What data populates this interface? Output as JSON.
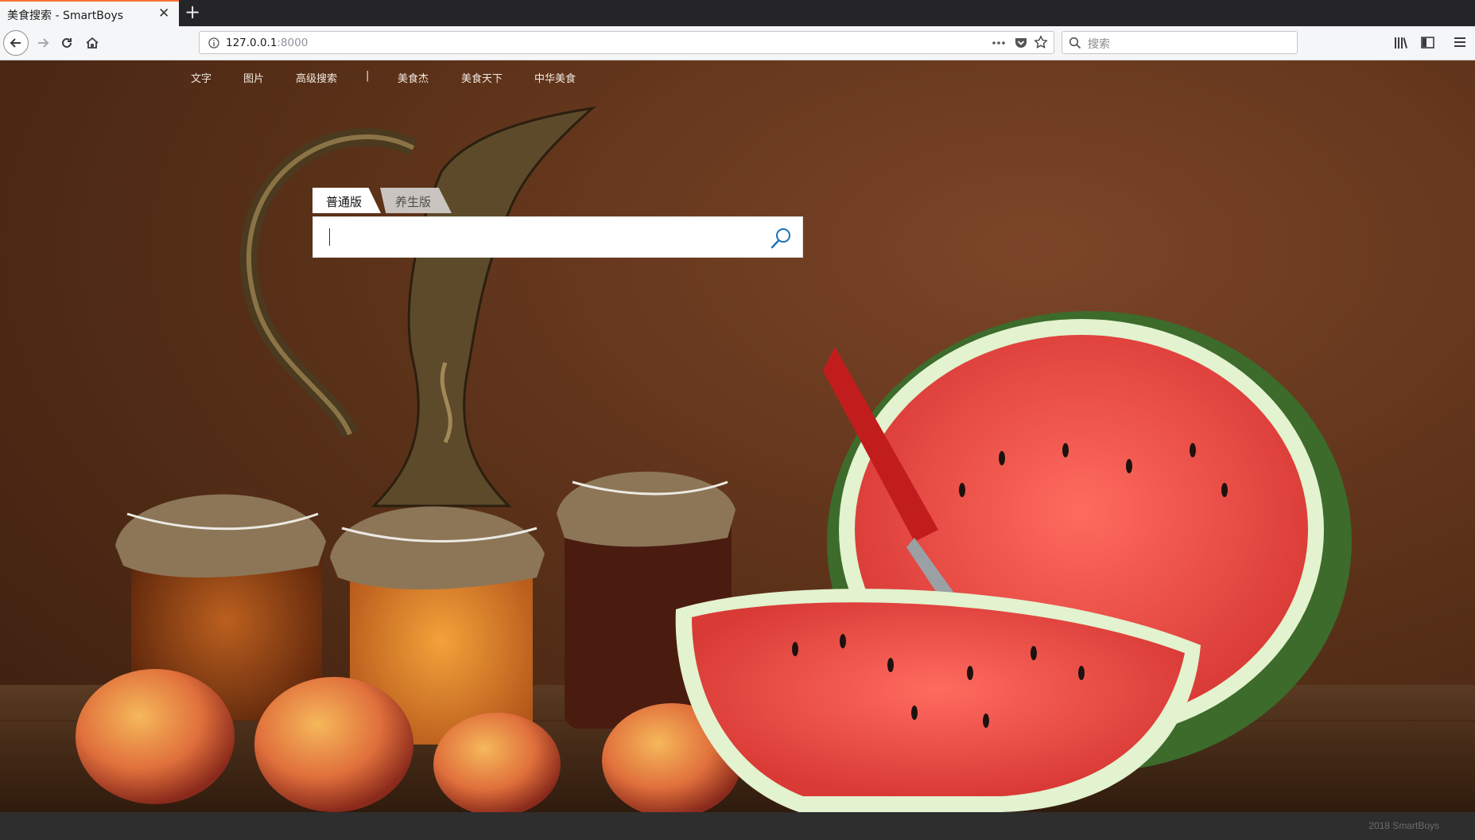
{
  "browser": {
    "tab_title": "美食搜索 - SmartBoys",
    "url_host": "127.0.0.1",
    "url_port": ":8000",
    "search_placeholder": "搜索",
    "accent_color": "#ff7139"
  },
  "nav_links": [
    "文字",
    "图片",
    "高级搜索",
    "|",
    "美食杰",
    "美食天下",
    "中华美食"
  ],
  "search": {
    "tabs": [
      "普通版",
      "养生版"
    ],
    "active_tab": "普通版",
    "input_value": "",
    "search_icon": "magnifier-icon"
  },
  "footer": {
    "text": "2018 SmartBoys"
  }
}
